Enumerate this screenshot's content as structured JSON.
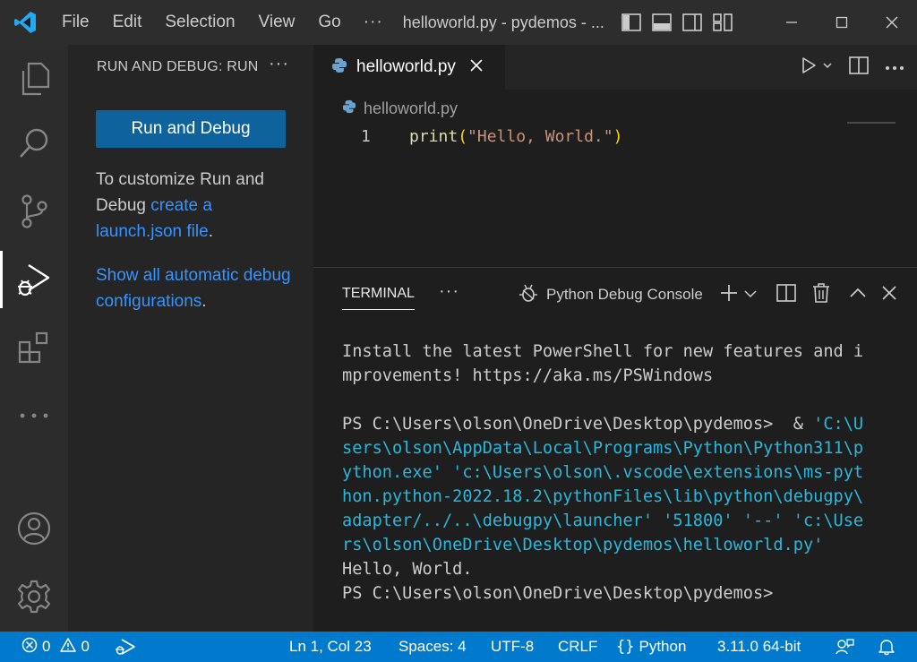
{
  "titlebar": {
    "menu": [
      "File",
      "Edit",
      "Selection",
      "View",
      "Go"
    ],
    "more": "···",
    "title": "helloworld.py - pydemos - ..."
  },
  "sidebar": {
    "header": "RUN AND DEBUG: RUN",
    "more": "···",
    "run_button": "Run and Debug",
    "customize_text_1": "To customize Run and Debug ",
    "customize_link": "create a launch.json file",
    "customize_text_2": ".",
    "show_link": "Show all automatic debug configurations",
    "show_text_2": "."
  },
  "editor": {
    "tab_label": "helloworld.py",
    "breadcrumb": "helloworld.py",
    "line_number": "1",
    "code": {
      "fn": "print",
      "open": "(",
      "str": "\"Hello, World.\"",
      "close": ")"
    }
  },
  "panel": {
    "tab": "TERMINAL",
    "more": "···",
    "terminal_name": "Python Debug Console",
    "lines": [
      {
        "plain": "Install the latest PowerShell for new features and i",
        "cmd": ""
      },
      {
        "plain": "mprovements! https://aka.ms/PSWindows",
        "cmd": ""
      },
      {
        "plain": " ",
        "cmd": ""
      },
      {
        "plain": "PS C:\\Users\\olson\\OneDrive\\Desktop\\pydemos>  & ",
        "cmd": "'C:\\U"
      },
      {
        "plain": "",
        "cmd": "sers\\olson\\AppData\\Local\\Programs\\Python\\Python311\\p"
      },
      {
        "plain": "",
        "cmd": "ython.exe' 'c:\\Users\\olson\\.vscode\\extensions\\ms-pyt"
      },
      {
        "plain": "",
        "cmd": "hon.python-2022.18.2\\pythonFiles\\lib\\python\\debugpy\\"
      },
      {
        "plain": "",
        "cmd": "adapter/../..\\debugpy\\launcher' '51800' '--' 'c:\\Use"
      },
      {
        "plain": "",
        "cmd": "rs\\olson\\OneDrive\\Desktop\\pydemos\\helloworld.py'"
      },
      {
        "plain": "Hello, World.",
        "cmd": ""
      },
      {
        "plain": "PS C:\\Users\\olson\\OneDrive\\Desktop\\pydemos>",
        "cmd": ""
      }
    ]
  },
  "statusbar": {
    "errors": "0",
    "warnings": "0",
    "position": "Ln 1, Col 23",
    "spaces": "Spaces: 4",
    "encoding": "UTF-8",
    "eol": "CRLF",
    "language": "Python",
    "interpreter": "3.11.0 64-bit"
  },
  "colors": {
    "accent": "#007acc",
    "button": "#0e639c",
    "link": "#3794ff"
  }
}
